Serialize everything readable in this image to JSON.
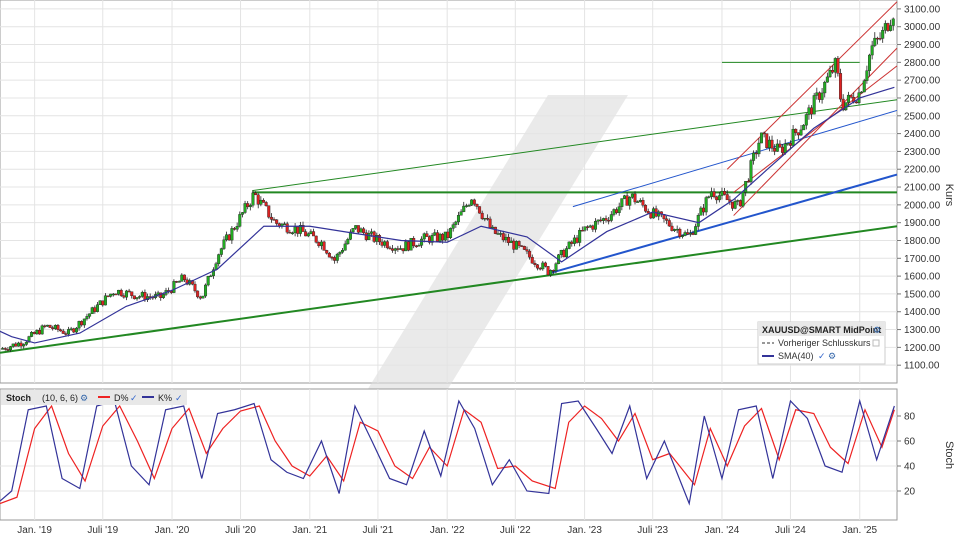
{
  "price_panel": {
    "ylabel": "Kurs",
    "y_ticks": [
      "1100.00",
      "1200.00",
      "1300.00",
      "1400.00",
      "1500.00",
      "1600.00",
      "1700.00",
      "1800.00",
      "1900.00",
      "2000.00",
      "2100.00",
      "2200.00",
      "2300.00",
      "2400.00",
      "2500.00",
      "2600.00",
      "2700.00",
      "2800.00",
      "2900.00",
      "3000.00",
      "3100.00"
    ],
    "legend": {
      "title": "XAUUSD@SMART MidPoint",
      "prev_close_label": "Vorheriger Schlusskurs",
      "sma_label": "SMA(40)"
    }
  },
  "stoch_panel": {
    "title": "Stoch",
    "params": "(10, 6, 6)",
    "d_label": "D%",
    "k_label": "K%",
    "ylabel": "Stoch",
    "y_ticks": [
      "80",
      "60",
      "40",
      "20"
    ]
  },
  "x_ticks": [
    "Jan. '19",
    "Juli '19",
    "Jan. '20",
    "Juli '20",
    "Jan. '21",
    "Juli '21",
    "Jan. '22",
    "Juli '22",
    "Jan. '23",
    "Juli '23",
    "Jan. '24",
    "Juli '24",
    "Jan. '25"
  ],
  "colors": {
    "candle_up": "#22aa22",
    "candle_down": "#dd2222",
    "sma": "#333399",
    "k_line": "#333399",
    "d_line": "#ee2222",
    "trend_green": "#228822",
    "trend_blue": "#2255cc",
    "channel_red": "#cc3333"
  },
  "chart_data": [
    {
      "type": "candlestick",
      "title": "XAUUSD@SMART MidPoint",
      "ylabel": "Kurs",
      "ylim": [
        1000,
        3150
      ],
      "x_range": [
        "2018-10-01",
        "2025-04-10"
      ],
      "x_ticks": [
        "Jan. '19",
        "Juli '19",
        "Jan. '20",
        "Juli '20",
        "Jan. '21",
        "Juli '21",
        "Jan. '22",
        "Juli '22",
        "Jan. '23",
        "Juli '23",
        "Jan. '24",
        "Juli '24",
        "Jan. '25"
      ],
      "grid": true,
      "legend_position": "bottom-right",
      "series": [
        {
          "name": "XAUUSD@SMART MidPoint",
          "kind": "close",
          "x": [
            "2018-10-01",
            "2018-12-01",
            "2019-02-01",
            "2019-04-01",
            "2019-06-01",
            "2019-08-01",
            "2019-10-01",
            "2019-12-01",
            "2020-02-01",
            "2020-03-20",
            "2020-05-01",
            "2020-08-06",
            "2020-10-01",
            "2020-12-01",
            "2021-02-01",
            "2021-03-08",
            "2021-05-01",
            "2021-07-01",
            "2021-09-01",
            "2021-11-01",
            "2022-01-01",
            "2022-03-08",
            "2022-05-01",
            "2022-07-01",
            "2022-09-28",
            "2022-11-01",
            "2023-01-01",
            "2023-03-01",
            "2023-05-04",
            "2023-07-01",
            "2023-10-06",
            "2023-12-04",
            "2024-02-14",
            "2024-04-12",
            "2024-06-01",
            "2024-08-01",
            "2024-10-30",
            "2024-11-14",
            "2025-01-01",
            "2025-02-01",
            "2025-03-01",
            "2025-04-03"
          ],
          "values": [
            1190,
            1230,
            1320,
            1280,
            1400,
            1520,
            1490,
            1480,
            1590,
            1480,
            1720,
            2060,
            1900,
            1860,
            1790,
            1690,
            1870,
            1800,
            1760,
            1810,
            1820,
            2050,
            1850,
            1770,
            1625,
            1720,
            1860,
            1930,
            2050,
            1950,
            1820,
            2080,
            1990,
            2380,
            2300,
            2450,
            2790,
            2560,
            2630,
            2880,
            2950,
            3100
          ]
        },
        {
          "name": "SMA(40)",
          "kind": "line",
          "x": [
            "2018-10-01",
            "2018-11-01",
            "2019-01-01",
            "2019-05-01",
            "2019-09-01",
            "2020-01-01",
            "2020-05-01",
            "2020-09-01",
            "2021-01-01",
            "2021-05-01",
            "2021-09-01",
            "2022-01-01",
            "2022-04-01",
            "2022-08-01",
            "2022-11-01",
            "2023-03-01",
            "2023-07-01",
            "2023-11-01",
            "2024-02-01",
            "2024-05-01",
            "2024-09-01",
            "2025-01-01",
            "2025-04-03"
          ],
          "values": [
            1290,
            1260,
            1225,
            1280,
            1430,
            1520,
            1640,
            1880,
            1880,
            1840,
            1800,
            1790,
            1880,
            1820,
            1680,
            1850,
            1960,
            1900,
            2030,
            2200,
            2430,
            2600,
            2660
          ]
        }
      ]
    },
    {
      "type": "line",
      "title": "Stoch",
      "subtitle": "(10, 6, 6)",
      "ylabel": "Stoch",
      "ylim": [
        0,
        100
      ],
      "x_range": [
        "2018-10-01",
        "2025-04-10"
      ],
      "grid": true,
      "legend_position": "top-left",
      "series": [
        {
          "name": "K%",
          "x": [
            "2018-10-01",
            "2018-11-01",
            "2018-12-15",
            "2019-02-01",
            "2019-03-15",
            "2019-05-01",
            "2019-06-15",
            "2019-08-01",
            "2019-09-15",
            "2019-11-01",
            "2019-12-15",
            "2020-02-01",
            "2020-03-20",
            "2020-05-01",
            "2020-06-15",
            "2020-08-06",
            "2020-09-20",
            "2020-11-01",
            "2020-12-15",
            "2021-02-01",
            "2021-03-20",
            "2021-05-01",
            "2021-06-15",
            "2021-08-01",
            "2021-09-15",
            "2021-11-01",
            "2021-12-15",
            "2022-02-01",
            "2022-03-15",
            "2022-05-01",
            "2022-06-15",
            "2022-08-01",
            "2022-09-28",
            "2022-11-01",
            "2022-12-15",
            "2023-02-01",
            "2023-03-15",
            "2023-05-01",
            "2023-06-15",
            "2023-08-01",
            "2023-10-06",
            "2023-11-15",
            "2024-01-01",
            "2024-02-14",
            "2024-04-01",
            "2024-05-15",
            "2024-07-01",
            "2024-08-15",
            "2024-10-01",
            "2024-11-15",
            "2025-01-01",
            "2025-02-15",
            "2025-04-03"
          ],
          "values": [
            12,
            20,
            85,
            88,
            30,
            22,
            88,
            92,
            40,
            25,
            85,
            88,
            30,
            82,
            85,
            90,
            45,
            35,
            30,
            60,
            18,
            88,
            60,
            30,
            25,
            68,
            32,
            92,
            70,
            25,
            45,
            20,
            18,
            90,
            92,
            70,
            50,
            88,
            30,
            60,
            10,
            80,
            30,
            85,
            88,
            30,
            92,
            78,
            40,
            35,
            92,
            45,
            88
          ]
        },
        {
          "name": "D%",
          "x": [
            "2018-10-01",
            "2018-11-15",
            "2019-01-01",
            "2019-02-15",
            "2019-04-01",
            "2019-05-15",
            "2019-07-01",
            "2019-08-15",
            "2019-10-01",
            "2019-11-15",
            "2020-01-01",
            "2020-02-15",
            "2020-04-01",
            "2020-05-15",
            "2020-07-01",
            "2020-08-20",
            "2020-10-01",
            "2020-11-15",
            "2021-01-01",
            "2021-02-15",
            "2021-04-01",
            "2021-05-15",
            "2021-07-01",
            "2021-08-15",
            "2021-10-01",
            "2021-11-15",
            "2022-01-01",
            "2022-02-15",
            "2022-04-01",
            "2022-05-15",
            "2022-07-01",
            "2022-08-15",
            "2022-10-15",
            "2022-11-20",
            "2023-01-01",
            "2023-02-15",
            "2023-04-01",
            "2023-05-15",
            "2023-07-01",
            "2023-08-15",
            "2023-10-20",
            "2023-12-01",
            "2024-01-15",
            "2024-03-01",
            "2024-04-15",
            "2024-06-01",
            "2024-07-15",
            "2024-09-01",
            "2024-10-15",
            "2024-12-01",
            "2025-01-15",
            "2025-03-01",
            "2025-04-03"
          ],
          "values": [
            10,
            15,
            70,
            88,
            50,
            28,
            72,
            88,
            60,
            30,
            70,
            86,
            50,
            70,
            84,
            88,
            60,
            40,
            32,
            48,
            28,
            75,
            68,
            40,
            30,
            55,
            40,
            85,
            75,
            38,
            40,
            28,
            22,
            75,
            88,
            78,
            60,
            82,
            45,
            50,
            25,
            70,
            40,
            72,
            86,
            45,
            85,
            82,
            55,
            42,
            85,
            55,
            85
          ]
        }
      ]
    }
  ]
}
